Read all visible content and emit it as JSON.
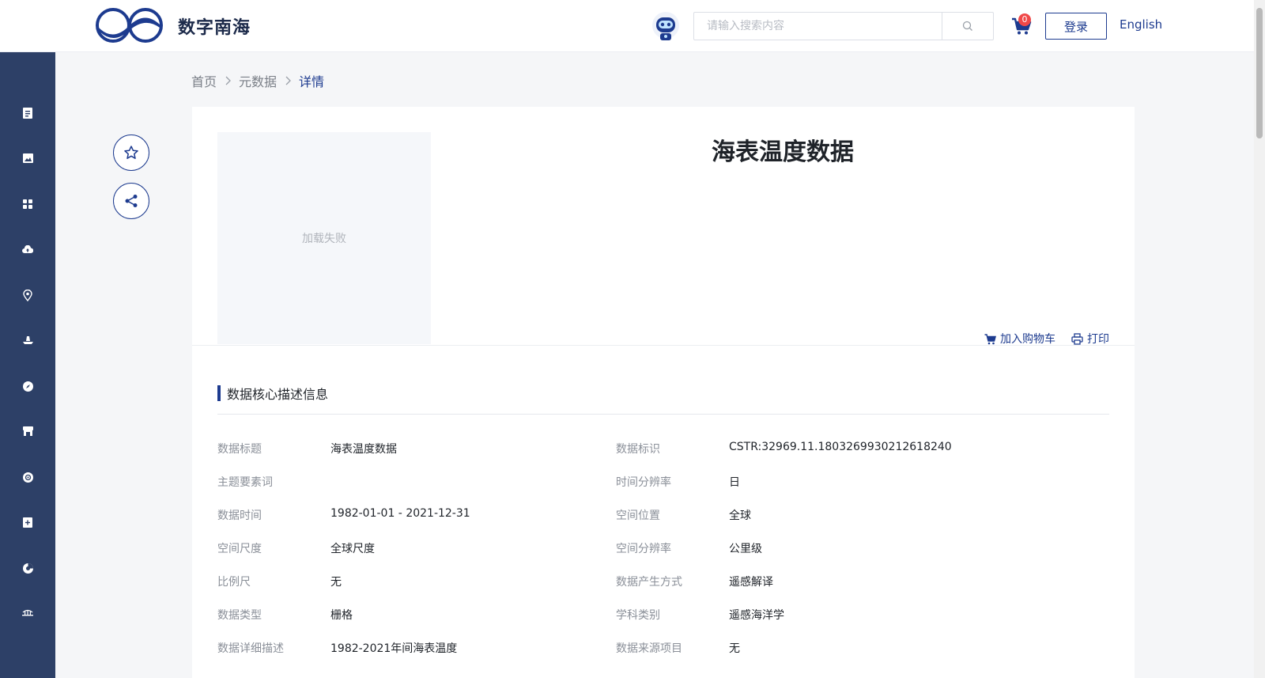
{
  "header": {
    "brand": "数字南海",
    "search_placeholder": "请输入搜索内容",
    "cart_count": "0",
    "login_label": "登录",
    "lang_label": "English"
  },
  "sidebar": {
    "icons": [
      "document-icon",
      "image-icon",
      "apps-icon",
      "cloud-upload-icon",
      "location-icon",
      "ship-icon",
      "compass-icon",
      "store-icon",
      "globe-icon",
      "add-box-icon",
      "pie-chart-icon",
      "bridge-icon"
    ]
  },
  "breadcrumb": {
    "items": [
      "首页",
      "元数据",
      "详情"
    ]
  },
  "detail": {
    "thumb_text": "加载失败",
    "title": "海表温度数据",
    "add_cart_label": "加入购物车",
    "print_label": "打印",
    "section_title": "数据核心描述信息"
  },
  "fields": [
    {
      "left_label": "数据标题",
      "left_value": "海表温度数据",
      "right_label": "数据标识",
      "right_value": "CSTR:32969.11.1803269930212618240"
    },
    {
      "left_label": "主题要素词",
      "left_value": "",
      "right_label": "时间分辨率",
      "right_value": "日"
    },
    {
      "left_label": "数据时间",
      "left_value": "1982-01-01 - 2021-12-31",
      "right_label": "空间位置",
      "right_value": "全球"
    },
    {
      "left_label": "空间尺度",
      "left_value": "全球尺度",
      "right_label": "空间分辨率",
      "right_value": "公里级"
    },
    {
      "left_label": "比例尺",
      "left_value": "无",
      "right_label": "数据产生方式",
      "right_value": "遥感解译"
    },
    {
      "left_label": "数据类型",
      "left_value": "栅格",
      "right_label": "学科类别",
      "right_value": "遥感海洋学"
    },
    {
      "left_label": "数据详细描述",
      "left_value": "1982-2021年间海表温度",
      "right_label": "数据来源项目",
      "right_value": "无"
    }
  ],
  "colors": {
    "brand": "#1d3b8f",
    "sidebar_bg": "#2d4067",
    "badge": "#f04848"
  }
}
